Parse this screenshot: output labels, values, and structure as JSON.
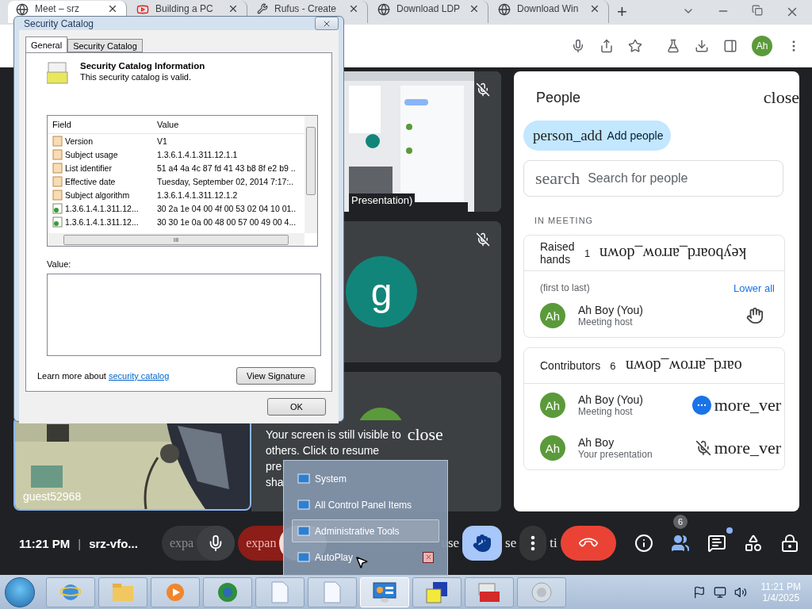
{
  "browser": {
    "tabs": [
      {
        "title": "Meet – srz",
        "selected": true
      },
      {
        "title": "Building a PC",
        "selected": false
      },
      {
        "title": "Rufus - Create",
        "selected": false
      },
      {
        "title": "Download LDP",
        "selected": false
      },
      {
        "title": "Download Win",
        "selected": false
      }
    ],
    "new_tab": "+",
    "profile": "Ah"
  },
  "meet": {
    "tiles": [
      {
        "kind": "presentation",
        "label": "Presentation)",
        "muted": true
      },
      {
        "kind": "avatar",
        "initial": "g",
        "muted": true
      },
      {
        "kind": "partial",
        "muted": false
      }
    ],
    "video": {
      "label": "guest52968"
    },
    "notice": {
      "lines": [
        "Your screen is still visible to",
        "others. Click to resume",
        "pre",
        "sha"
      ],
      "close": "close"
    },
    "toolbar": {
      "time": "11:21 PM",
      "separator": "|",
      "meeting_code": "srz-vfo...",
      "controls": [
        {
          "kind": "mic",
          "expand": "expa"
        },
        {
          "kind": "camera",
          "expand": "expan"
        },
        {
          "kind": "fragment",
          "label": "use"
        },
        {
          "kind": "hand",
          "selected": true
        },
        {
          "kind": "fragment",
          "label": "se"
        },
        {
          "kind": "more"
        },
        {
          "kind": "fragment",
          "label": "ti"
        },
        {
          "kind": "hangup"
        }
      ],
      "actions": [
        {
          "kind": "info"
        },
        {
          "kind": "people",
          "badge": "6",
          "selected": true
        },
        {
          "kind": "chat",
          "unread": true
        },
        {
          "kind": "activities"
        },
        {
          "kind": "host"
        }
      ]
    }
  },
  "people_panel": {
    "title": "People",
    "close": "close",
    "add_icon_text": "person_add",
    "add_label": "Add people",
    "search_icon_text": "search",
    "search_placeholder": "Search for people",
    "section_label": "IN MEETING",
    "groups": [
      {
        "title": "Raised hands",
        "count": "1",
        "arrow": "keyboard_arrow_down",
        "note": "(first to last)",
        "action": "Lower all",
        "people": [
          {
            "initials": "Ah",
            "name": "Ah Boy (You)",
            "role": "Meeting host",
            "kind": "hand"
          }
        ]
      },
      {
        "title": "Contributors",
        "count": "6",
        "arrow": "oard_arrow_down",
        "people": [
          {
            "initials": "Ah",
            "name": "Ah Boy (You)",
            "role": "Meeting host",
            "kind": "menu",
            "menu_text": "more_ver"
          },
          {
            "initials": "Ah",
            "name": "Ah Boy",
            "role": "Your presentation",
            "kind": "muted",
            "menu_text": "more_ver"
          }
        ]
      }
    ]
  },
  "dialog": {
    "title": "Security Catalog",
    "tabs": [
      {
        "label": "General",
        "selected": true
      },
      {
        "label": "Security Catalog",
        "selected": false
      }
    ],
    "heading": "Security Catalog Information",
    "status": "This security catalog is valid.",
    "columns": [
      "Field",
      "Value"
    ],
    "rows": [
      {
        "kind": "property",
        "field": "Version",
        "value": "V1"
      },
      {
        "kind": "property",
        "field": "Subject usage",
        "value": "1.3.6.1.4.1.311.12.1.1"
      },
      {
        "kind": "property",
        "field": "List identifier",
        "value": "51 a4 4a 4c 87 fd 41 43 b8 8f e2 b9 .."
      },
      {
        "kind": "property",
        "field": "Effective date",
        "value": "Tuesday, September 02, 2014 7:17:.."
      },
      {
        "kind": "property",
        "field": "Subject algorithm",
        "value": "1.3.6.1.4.1.311.12.1.2"
      },
      {
        "kind": "extension",
        "field": "1.3.6.1.4.1.311.12...",
        "value": "30 2a 1e 04 00 4f 00 53 02 04 10 01.."
      },
      {
        "kind": "extension",
        "field": "1.3.6.1.4.1.311.12...",
        "value": "30 30 1e 0a 00 48 00 57 00 49 00 4..."
      }
    ],
    "hscroll_grip": "III",
    "value_label": "Value:",
    "learn_more": "Learn more about",
    "link": "security catalog",
    "view_button": "View Signature",
    "ok_button": "OK"
  },
  "jump_list": {
    "items": [
      {
        "label": "System",
        "selected": false,
        "hovered": false
      },
      {
        "label": "All Control Panel Items",
        "selected": false,
        "hovered": false
      },
      {
        "label": "Administrative Tools",
        "selected": true,
        "hovered": false
      },
      {
        "label": "AutoPlay",
        "selected": false,
        "hovered": true
      }
    ]
  },
  "taskbar": {
    "apps": [
      {
        "kind": "ie",
        "active": false
      },
      {
        "kind": "folder",
        "active": false
      },
      {
        "kind": "media",
        "active": false
      },
      {
        "kind": "globe",
        "active": false
      },
      {
        "kind": "doc",
        "active": false
      },
      {
        "kind": "doc",
        "active": false
      },
      {
        "kind": "control",
        "active": true
      },
      {
        "kind": "box",
        "active": false
      },
      {
        "kind": "toolbox",
        "active": false
      },
      {
        "kind": "speaker",
        "active": false
      }
    ],
    "time": "11:21 PM",
    "date": "1/4/2025"
  }
}
